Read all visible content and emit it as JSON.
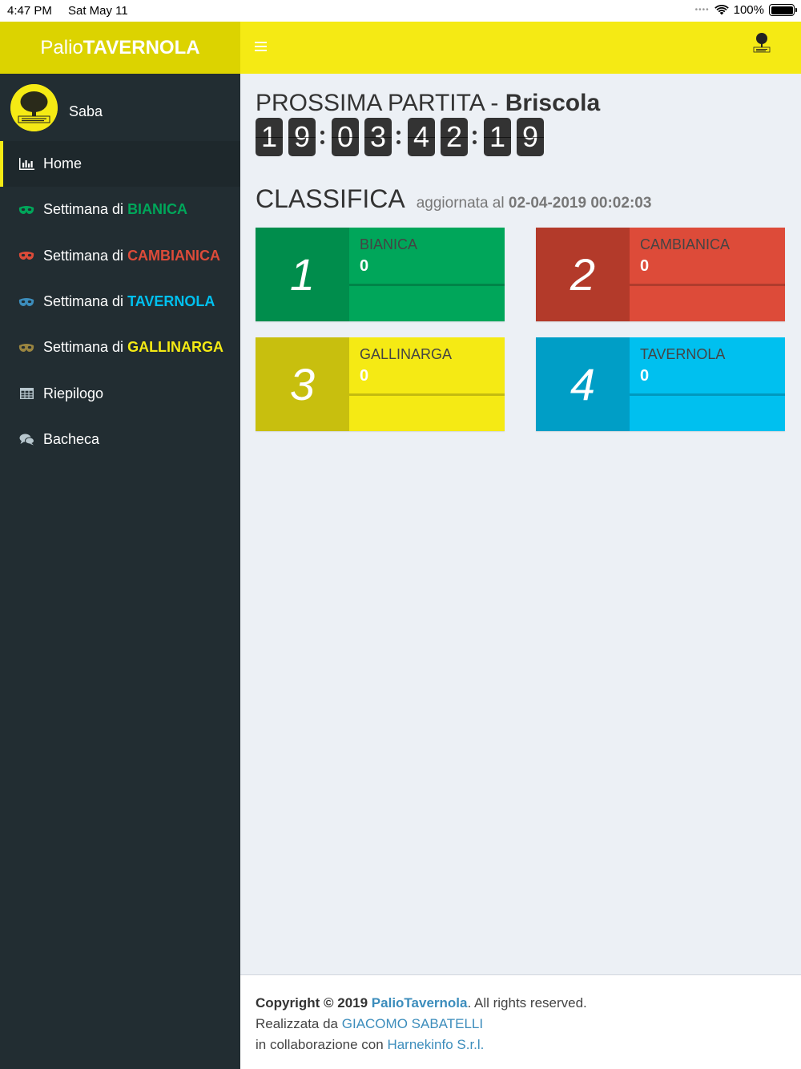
{
  "status_bar": {
    "time": "4:47 PM",
    "date": "Sat May 11",
    "battery": "100%"
  },
  "brand": {
    "prefix": "Palio",
    "name": "TAVERNOLA"
  },
  "user": {
    "name": "Saba"
  },
  "menu": [
    {
      "label": "Home",
      "highlight": "",
      "icon": "bar-chart-icon",
      "active": true
    },
    {
      "label": "Settimana di",
      "highlight": "BIANICA",
      "icon": "mask-icon",
      "color": "#00a65a"
    },
    {
      "label": "Settimana di",
      "highlight": "CAMBIANICA",
      "icon": "mask-icon",
      "color": "#dd4b39"
    },
    {
      "label": "Settimana di",
      "highlight": "TAVERNOLA",
      "icon": "mask-icon",
      "color": "#00c0ef"
    },
    {
      "label": "Settimana di",
      "highlight": "GALLINARGA",
      "icon": "mask-icon",
      "color": "#f5ea14"
    },
    {
      "label": "Riepilogo",
      "highlight": "",
      "icon": "table-icon"
    },
    {
      "label": "Bacheca",
      "highlight": "",
      "icon": "comments-icon"
    }
  ],
  "next_match": {
    "prefix": "PROSSIMA PARTITA -",
    "name": "Briscola",
    "countdown": [
      "1",
      "9",
      "0",
      "3",
      "4",
      "2",
      "1",
      "9"
    ]
  },
  "ranking": {
    "title": "CLASSIFICA",
    "updated_label": "aggiornata al",
    "updated_at": "02-04-2019 00:02:03",
    "teams": [
      {
        "rank": "1",
        "name": "BIANICA",
        "score": "0",
        "color": "#00a65a",
        "dark": "#008d4c"
      },
      {
        "rank": "2",
        "name": "CAMBIANICA",
        "score": "0",
        "color": "#dd4b39",
        "dark": "#b33a2a"
      },
      {
        "rank": "3",
        "name": "GALLINARGA",
        "score": "0",
        "color": "#f5ea14",
        "dark": "#c8bf0e"
      },
      {
        "rank": "4",
        "name": "TAVERNOLA",
        "score": "0",
        "color": "#00c0ef",
        "dark": "#009ec6"
      }
    ]
  },
  "footer": {
    "copyright": "Copyright © 2019",
    "site": "PalioTavernola",
    "rights": ". All rights reserved.",
    "made_by_label": "Realizzata da",
    "made_by": "GIACOMO SABATELLI",
    "collab_label": "in collaborazione con",
    "collab": "Harnekinfo S.r.l."
  }
}
